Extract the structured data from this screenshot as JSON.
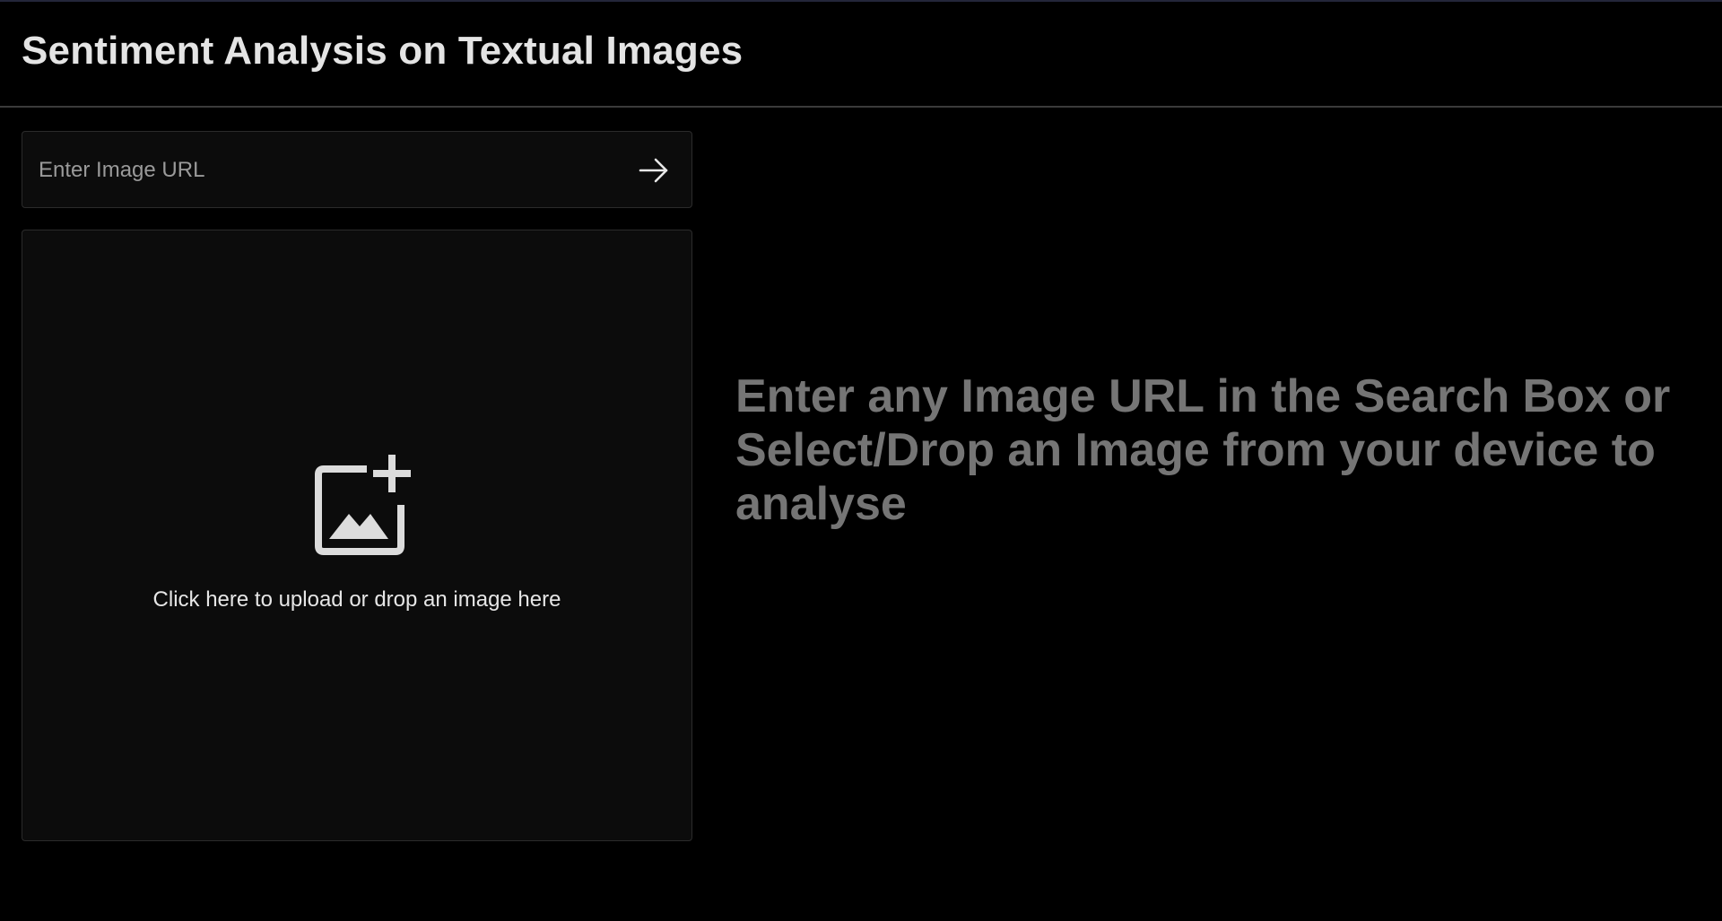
{
  "app": {
    "title": "Sentiment Analysis on Textual Images"
  },
  "search": {
    "placeholder": "Enter Image URL",
    "value": "",
    "submit_icon": "arrow-right-icon"
  },
  "upload": {
    "icon": "add-photo-icon",
    "label": "Click here to upload or drop an image here"
  },
  "main": {
    "hint": "Enter any Image URL in the Search Box or Select/Drop an Image from your device to analyse"
  },
  "colors": {
    "background": "#000000",
    "panel": "#0c0c0c",
    "title": "#e4e4e4",
    "hint": "#757575"
  }
}
